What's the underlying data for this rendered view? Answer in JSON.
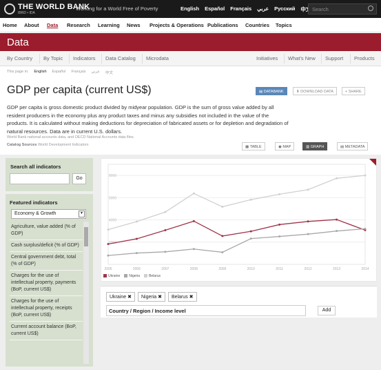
{
  "header": {
    "brand": "THE WORLD BANK",
    "brand_sub": "IBRD • IDA",
    "tagline": "Working for a World Free of Poverty",
    "languages": [
      "English",
      "Español",
      "Français",
      "عربي",
      "Русский",
      "中文"
    ],
    "search_placeholder": "Search"
  },
  "nav": {
    "items": [
      "Home",
      "About",
      "Data",
      "Research",
      "Learning",
      "News",
      "Projects & Operations",
      "Publications",
      "Countries",
      "Topics"
    ],
    "active": "Data"
  },
  "section": {
    "title": "Data"
  },
  "subnav": {
    "left": [
      "By Country",
      "By Topic",
      "Indicators",
      "Data Catalog",
      "Microdata"
    ],
    "right": [
      "Initiatives",
      "What's New",
      "Support",
      "Products"
    ]
  },
  "page_lang": {
    "label": "This page in:",
    "items": [
      "English",
      "Español",
      "Français",
      "عربي",
      "中文"
    ]
  },
  "page": {
    "title": "GDP per capita (current US$)",
    "buttons": {
      "databank": "DATABANK",
      "download": "DOWNLOAD DATA",
      "share": "SHARE"
    },
    "description": "GDP per capita is gross domestic product divided by midyear population. GDP is the sum of gross value added by all resident producers in the economy plus any product taxes and minus any subsidies not included in the value of the products. It is calculated without making deductions for depreciation of fabricated assets or for depletion and degradation of natural resources. Data are in current U.S. dollars.",
    "source_note": "World Bank national accounts data, and OECD National Accounts data files.",
    "catalog_label": "Catalog Sources",
    "catalog_value": "World Development Indicators",
    "views": [
      "TABLE",
      "MAP",
      "GRAPH",
      "METADATA"
    ],
    "active_view": "GRAPH"
  },
  "sidebar": {
    "search_label": "Search all indicators",
    "go": "Go",
    "featured_label": "Featured indicators",
    "category": "Economy & Growth",
    "indicators": [
      "Agriculture, value added (% of GDP)",
      "Cash surplus/deficit (% of GDP)",
      "Central government debt, total (% of GDP)",
      "Charges for the use of intellectual property, payments (BoP, current US$)",
      "Charges for the use of intellectual property, receipts (BoP, current US$)",
      "Current account balance (BoP, current US$)"
    ]
  },
  "chart_data": {
    "type": "line",
    "x": [
      "2005",
      "2006",
      "2007",
      "2008",
      "2009",
      "2010",
      "2011",
      "2012",
      "2013",
      "2014"
    ],
    "ylim": [
      0,
      9000
    ],
    "yticks": [
      "2000",
      "4000",
      "6000",
      "8000"
    ],
    "series": [
      {
        "name": "Ukraine",
        "color": "#a0344a",
        "values": [
          1830,
          2300,
          3070,
          3890,
          2550,
          2970,
          3580,
          3860,
          4030,
          3080
        ]
      },
      {
        "name": "Nigeria",
        "color": "#a8a8a8",
        "values": [
          800,
          1020,
          1130,
          1380,
          1090,
          2320,
          2510,
          2720,
          3000,
          3200
        ]
      },
      {
        "name": "Belarus",
        "color": "#d0d0d0",
        "values": [
          3130,
          3850,
          4710,
          6380,
          5180,
          5820,
          6310,
          6720,
          7740,
          8000
        ]
      }
    ]
  },
  "selection": {
    "chips": [
      "Ukraine",
      "Nigeria",
      "Belarus"
    ],
    "input_label": "Country / Region / Income level",
    "add": "Add"
  }
}
